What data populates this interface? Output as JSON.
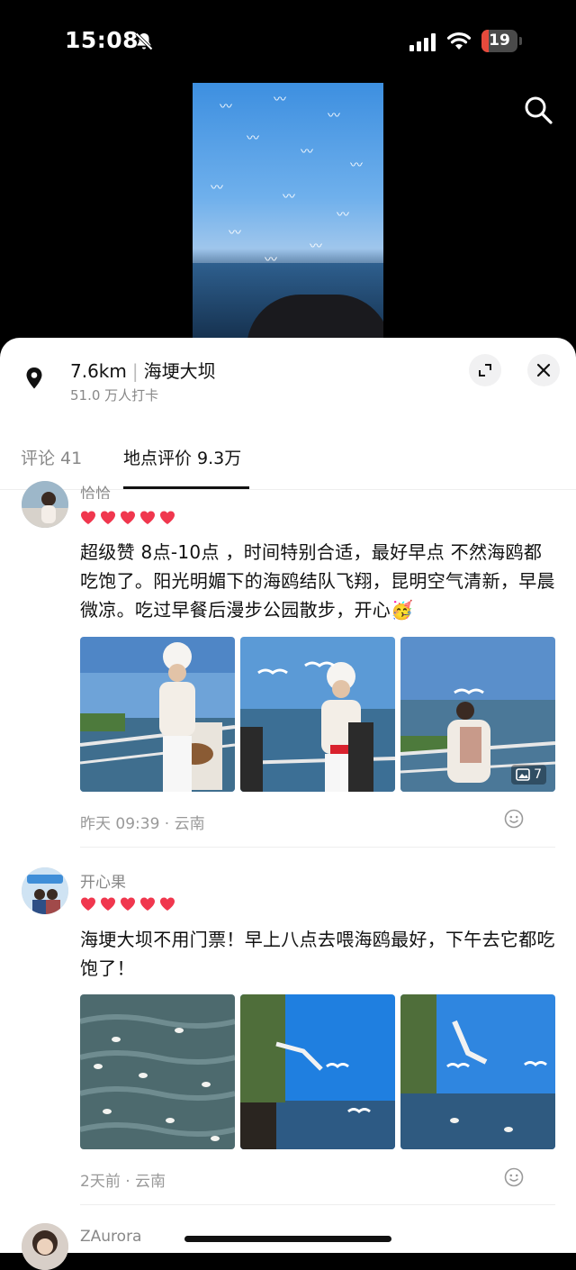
{
  "status_bar": {
    "time": "15:08",
    "battery": "19",
    "battery_level": 0.19
  },
  "location": {
    "distance": "7.6km",
    "name": "海埂大坝",
    "checkins": "51.0 万人打卡"
  },
  "tabs": [
    {
      "label": "评论 41",
      "active": false
    },
    {
      "label": "地点评价 9.3万",
      "active": true
    }
  ],
  "reviews": [
    {
      "username": "恰恰",
      "hearts": 5,
      "text": "超级赞 8点-10点 ，时间特别合适，最好早点 不然海鸥都吃饱了。阳光明媚下的海鸥结队飞翔，昆明空气清新，早晨微凉。吃过早餐后漫步公园散步，开心🥳",
      "photo_count": "7",
      "meta": "昨天 09:39 · 云南"
    },
    {
      "username": "开心果",
      "hearts": 5,
      "text": "海埂大坝不用门票！早上八点去喂海鸥最好，下午去它都吃饱了！",
      "meta": "2天前 · 云南"
    },
    {
      "username": "ZAurora"
    }
  ],
  "colors": {
    "heart": "#f0374e",
    "battery": "#e64a3c",
    "accent_text": "#111111",
    "muted_text": "#888888"
  },
  "icons": [
    "bell-slash-icon",
    "signal-icon",
    "wifi-icon",
    "battery-icon",
    "search-icon",
    "location-pin-icon",
    "expand-icon",
    "close-icon",
    "heart-icon",
    "gallery-icon",
    "smile-icon"
  ]
}
